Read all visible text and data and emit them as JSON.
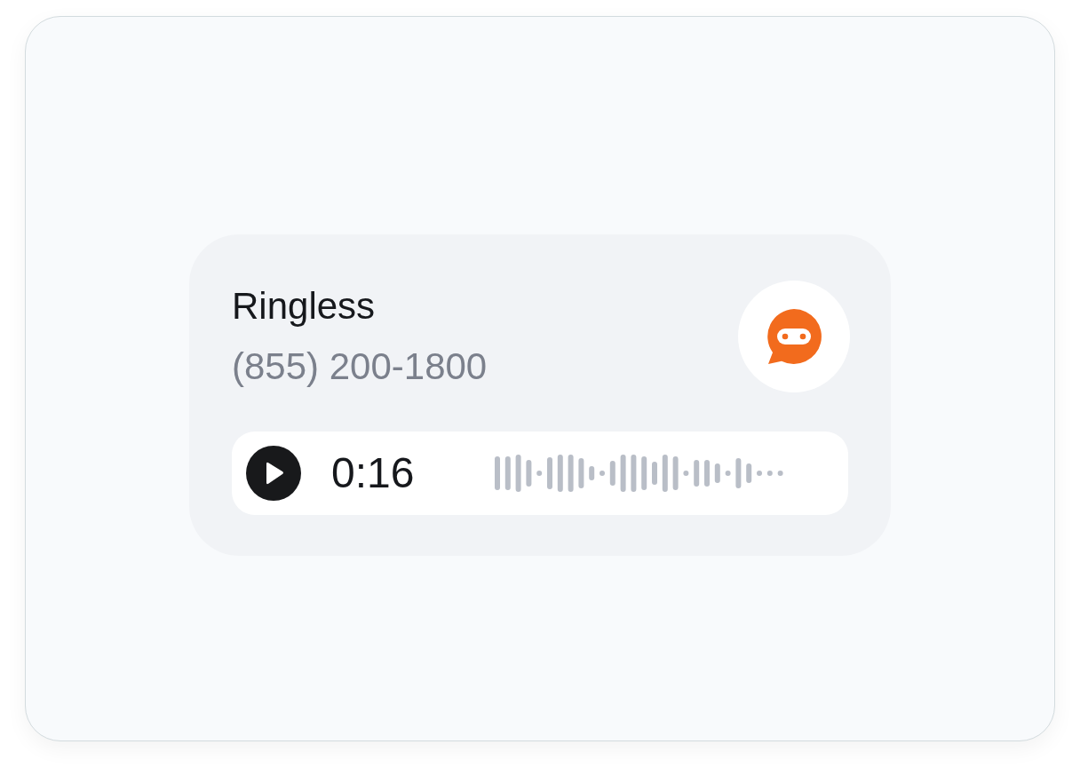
{
  "contact": {
    "name": "Ringless",
    "phone": "(855) 200-1800"
  },
  "player": {
    "duration": "0:16"
  }
}
